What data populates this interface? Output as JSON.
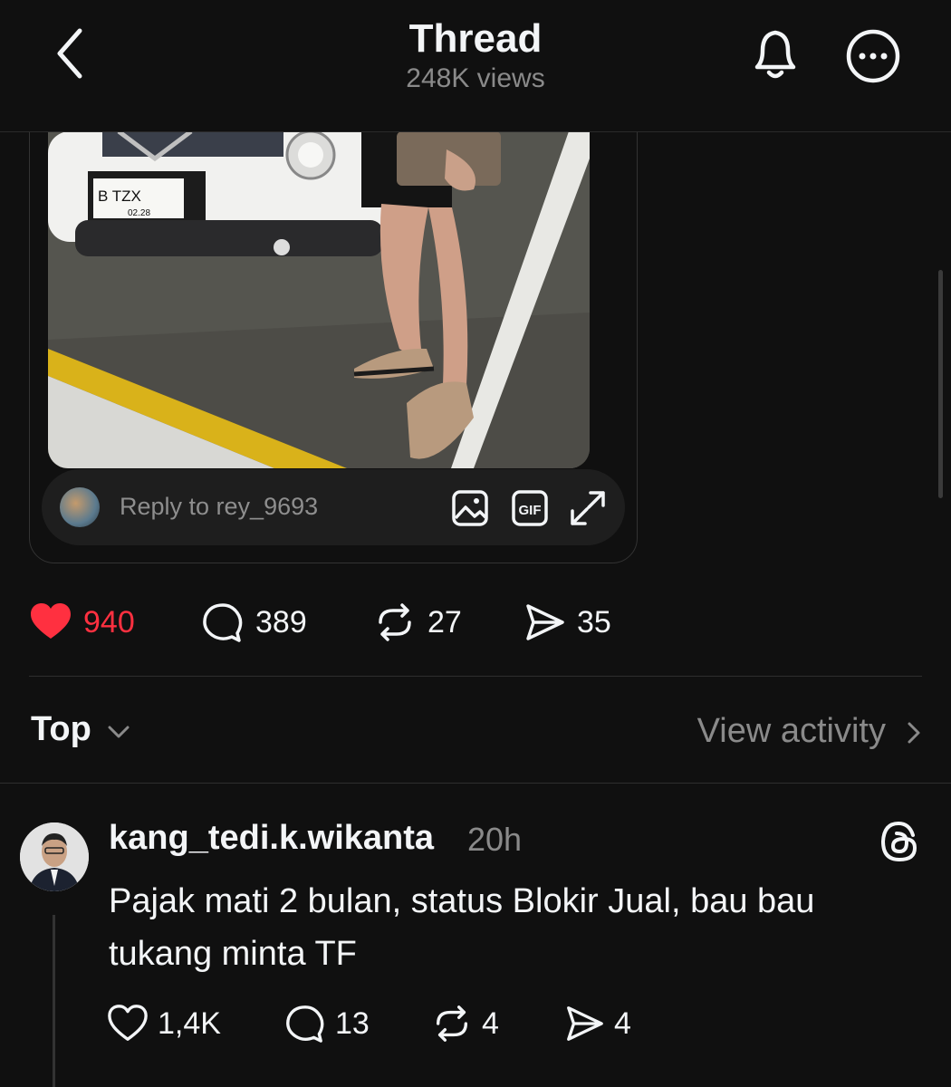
{
  "header": {
    "title": "Thread",
    "views": "248K views"
  },
  "post": {
    "reply_placeholder": "Reply to rey_9693",
    "plate_text": "B TZX",
    "plate_sub": "02.28",
    "media_icons": [
      "image-icon",
      "gif-icon",
      "expand-icon"
    ],
    "gif_label": "GIF",
    "stats": {
      "likes": "940",
      "comments": "389",
      "reposts": "27",
      "shares": "35"
    }
  },
  "sort": {
    "label": "Top",
    "view_activity": "View activity"
  },
  "comment": {
    "username": "kang_tedi.k.wikanta",
    "time": "20h",
    "text": "Pajak mati 2 bulan, status Blokir Jual, bau bau tukang minta TF",
    "stats": {
      "likes": "1,4K",
      "comments": "13",
      "reposts": "4",
      "shares": "4"
    }
  },
  "colors": {
    "background": "#101010",
    "like_red": "#ff3040",
    "muted": "#8a8a8a"
  }
}
